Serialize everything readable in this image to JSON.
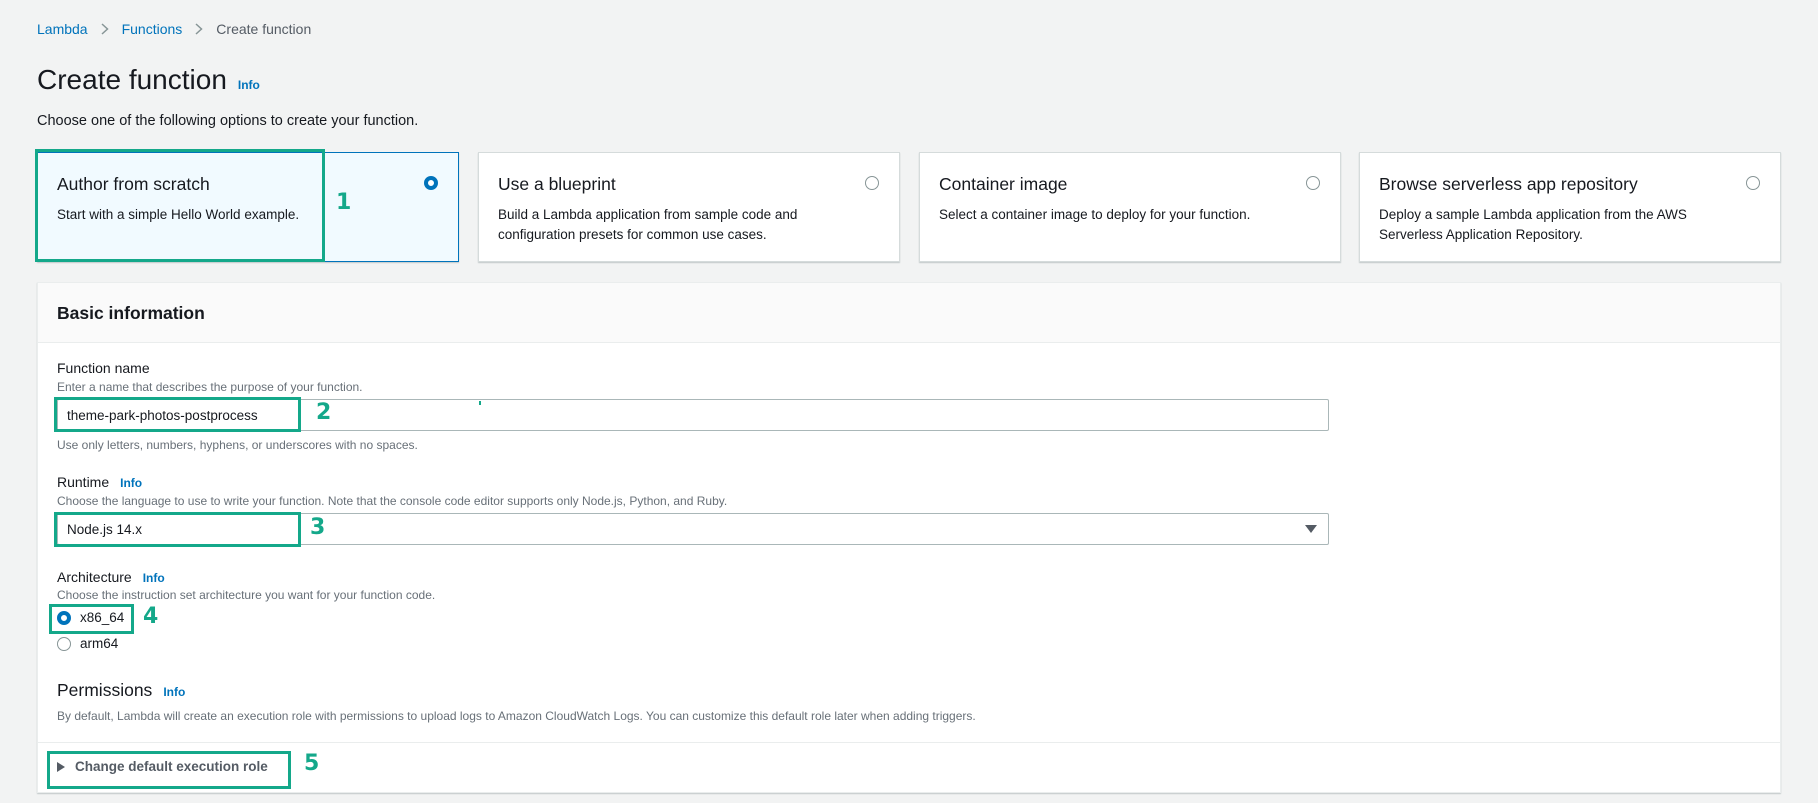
{
  "breadcrumb": {
    "items": [
      "Lambda",
      "Functions"
    ],
    "current": "Create function"
  },
  "page": {
    "title": "Create function",
    "info": "Info",
    "description": "Choose one of the following options to create your function."
  },
  "options": [
    {
      "title": "Author from scratch",
      "desc": "Start with a simple Hello World example.",
      "selected": true
    },
    {
      "title": "Use a blueprint",
      "desc": "Build a Lambda application from sample code and configuration presets for common use cases.",
      "selected": false
    },
    {
      "title": "Container image",
      "desc": "Select a container image to deploy for your function.",
      "selected": false
    },
    {
      "title": "Browse serverless app repository",
      "desc": "Deploy a sample Lambda application from the AWS Serverless Application Repository.",
      "selected": false
    }
  ],
  "basic": {
    "header": "Basic information",
    "function_name": {
      "label": "Function name",
      "desc": "Enter a name that describes the purpose of your function.",
      "value": "theme-park-photos-postprocess",
      "hint": "Use only letters, numbers, hyphens, or underscores with no spaces."
    },
    "runtime": {
      "label": "Runtime",
      "info": "Info",
      "desc": "Choose the language to use to write your function. Note that the console code editor supports only Node.js, Python, and Ruby.",
      "value": "Node.js 14.x"
    },
    "architecture": {
      "label": "Architecture",
      "info": "Info",
      "desc": "Choose the instruction set architecture you want for your function code.",
      "options": [
        "x86_64",
        "arm64"
      ],
      "selected": "x86_64"
    },
    "permissions": {
      "title": "Permissions",
      "info": "Info",
      "desc": "By default, Lambda will create an execution role with permissions to upload logs to Amazon CloudWatch Logs. You can customize this default role later when adding triggers."
    },
    "expander": "Change default execution role"
  },
  "annotations": [
    "1",
    "2",
    "3",
    "4",
    "5"
  ],
  "colors": {
    "accent": "#0073bb",
    "annotation": "#14a88a"
  }
}
